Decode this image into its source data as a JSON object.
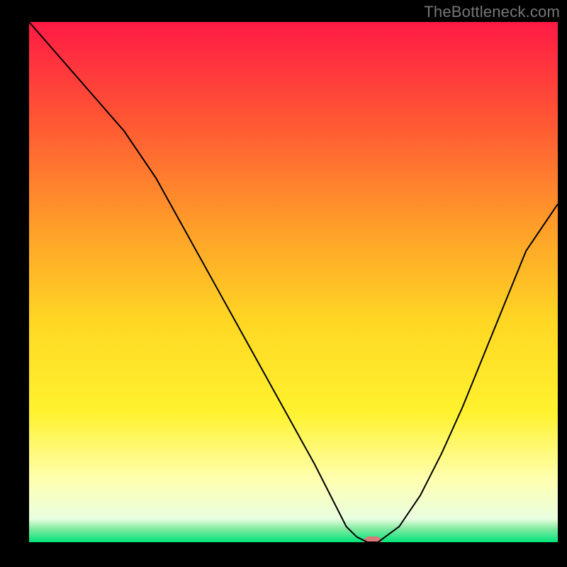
{
  "attribution": "TheBottleneck.com",
  "chart_data": {
    "type": "line",
    "title": "",
    "xlabel": "",
    "ylabel": "",
    "xlim": [
      0,
      100
    ],
    "ylim": [
      0,
      100
    ],
    "grid": false,
    "legend": false,
    "background": {
      "description": "Vertical gradient from red at top through orange, yellow, pale yellow to a thin green band at the bottom",
      "stops": [
        {
          "offset": 0.0,
          "color": "#ff1a45"
        },
        {
          "offset": 0.2,
          "color": "#ff5a33"
        },
        {
          "offset": 0.4,
          "color": "#ffa028"
        },
        {
          "offset": 0.58,
          "color": "#ffd824"
        },
        {
          "offset": 0.75,
          "color": "#fff22e"
        },
        {
          "offset": 0.88,
          "color": "#ffffb0"
        },
        {
          "offset": 0.955,
          "color": "#e9ffe0"
        },
        {
          "offset": 0.975,
          "color": "#7fe9a0"
        },
        {
          "offset": 1.0,
          "color": "#00e47a"
        }
      ]
    },
    "series": [
      {
        "name": "bottleneck-curve",
        "color": "#000000",
        "stroke_width": 2,
        "x": [
          0,
          6,
          12,
          18,
          24,
          30,
          36,
          42,
          48,
          54,
          58,
          60,
          62,
          64,
          66,
          70,
          74,
          78,
          82,
          86,
          90,
          94,
          98,
          100
        ],
        "y": [
          100,
          93,
          86,
          79,
          70,
          59,
          48,
          37,
          26,
          15,
          7,
          3,
          1,
          0,
          0,
          3,
          9,
          17,
          26,
          36,
          46,
          56,
          62,
          65
        ]
      }
    ],
    "markers": [
      {
        "name": "optimal-marker",
        "shape": "rounded-rect",
        "x": 65,
        "y": 0,
        "width_x": 3.5,
        "height_y": 2.2,
        "color": "#d77a7a"
      }
    ]
  }
}
